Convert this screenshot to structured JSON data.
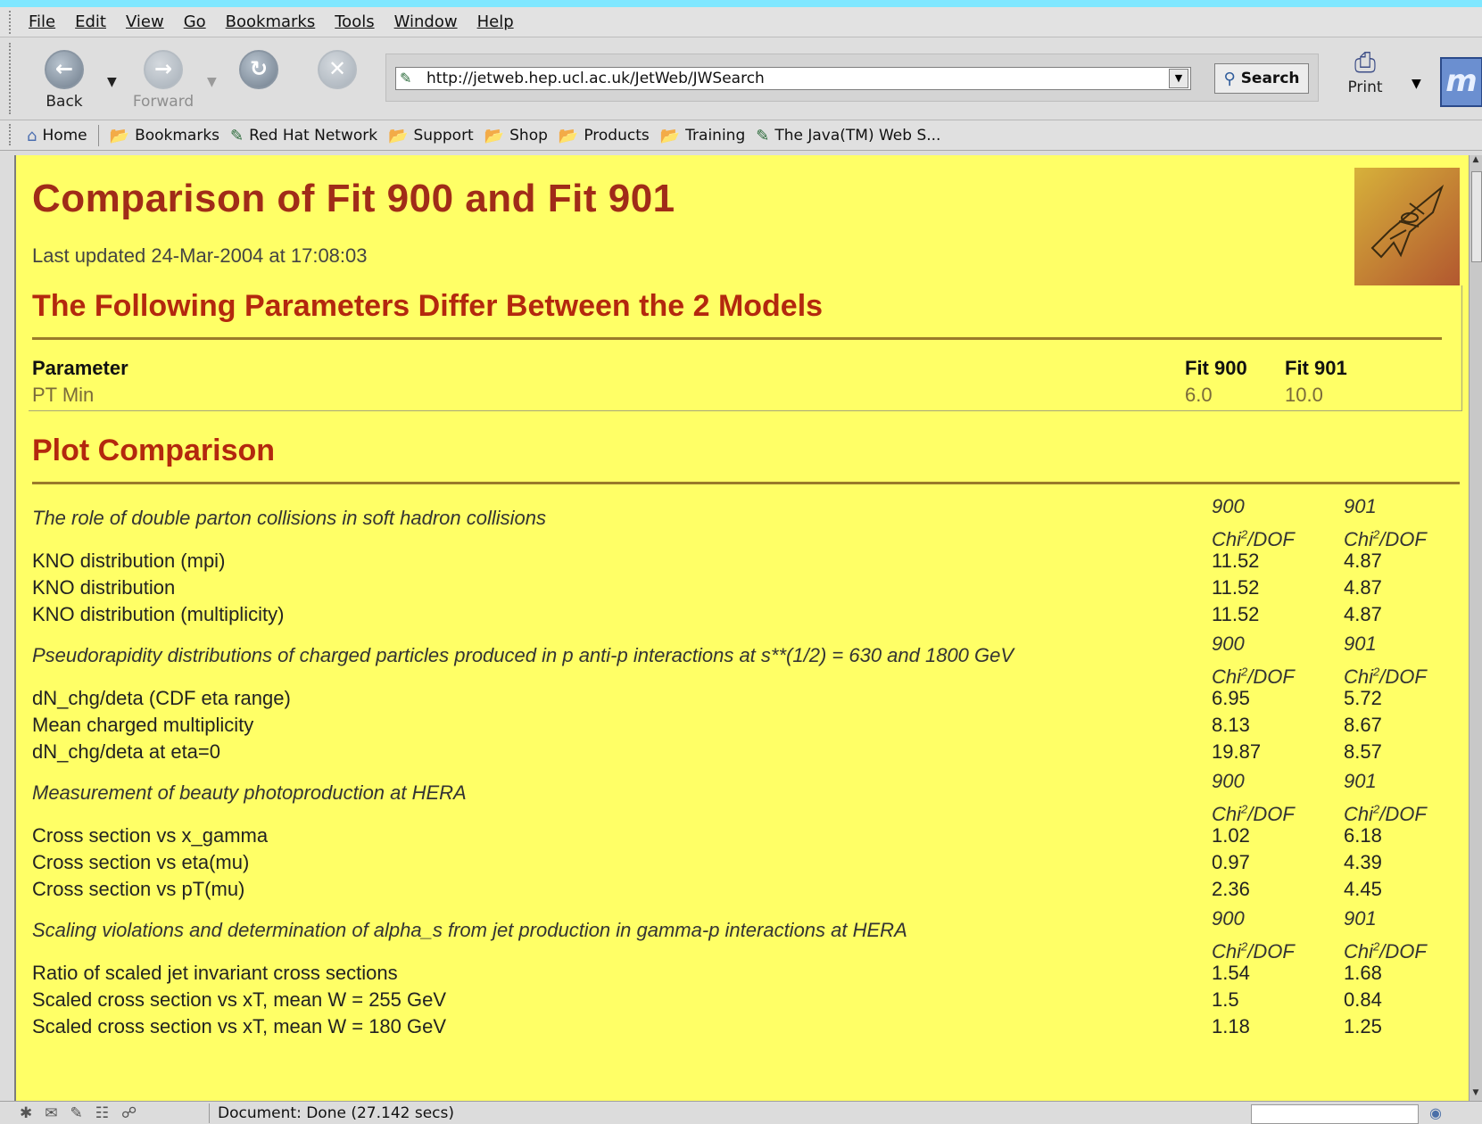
{
  "menubar": {
    "items": [
      {
        "label": "File"
      },
      {
        "label": "Edit"
      },
      {
        "label": "View"
      },
      {
        "label": "Go"
      },
      {
        "label": "Bookmarks"
      },
      {
        "label": "Tools"
      },
      {
        "label": "Window"
      },
      {
        "label": "Help"
      }
    ]
  },
  "navbar": {
    "back_label": "Back",
    "forward_label": "Forward",
    "url": "http://jetweb.hep.ucl.ac.uk/JetWeb/JWSearch",
    "search_label": "Search",
    "print_label": "Print"
  },
  "bookmarks": {
    "home": "Home",
    "bookmarks": "Bookmarks",
    "red_hat_network": "Red Hat Network",
    "support": "Support",
    "shop": "Shop",
    "products": "Products",
    "training": "Training",
    "java": "The Java(TM) Web S..."
  },
  "page": {
    "title": "Comparison of Fit 900 and Fit 901",
    "updated": "Last updated 24-Mar-2004 at 17:08:03",
    "params_heading": "The Following Parameters Differ Between the 2 Models",
    "params_table": {
      "col_param": "Parameter",
      "col_fit1": "Fit 900",
      "col_fit2": "Fit 901",
      "rows": [
        {
          "name": "PT Min",
          "fit1": "6.0",
          "fit2": "10.0"
        }
      ]
    },
    "plot_heading": "Plot Comparison",
    "group_col1": "900",
    "group_col2": "901",
    "chi_label": "Chi",
    "chi_sup": "2",
    "chi_suffix": "/DOF",
    "groups": [
      {
        "title": "The role of double parton collisions in soft hadron collisions",
        "rows": [
          {
            "name": "KNO distribution (mpi)",
            "v1": "11.52",
            "v2": "4.87"
          },
          {
            "name": "KNO distribution",
            "v1": "11.52",
            "v2": "4.87"
          },
          {
            "name": "KNO distribution (multiplicity)",
            "v1": "11.52",
            "v2": "4.87"
          }
        ]
      },
      {
        "title": "Pseudorapidity distributions of charged particles produced in p anti-p interactions at s**(1/2) = 630 and 1800 GeV",
        "rows": [
          {
            "name": "dN_chg/deta (CDF eta range)",
            "v1": "6.95",
            "v2": "5.72"
          },
          {
            "name": "Mean charged multiplicity",
            "v1": "8.13",
            "v2": "8.67"
          },
          {
            "name": "dN_chg/deta at eta=0",
            "v1": "19.87",
            "v2": "8.57"
          }
        ]
      },
      {
        "title": "Measurement of beauty photoproduction at HERA",
        "rows": [
          {
            "name": "Cross section vs x_gamma",
            "v1": "1.02",
            "v2": "6.18"
          },
          {
            "name": "Cross section vs eta(mu)",
            "v1": "0.97",
            "v2": "4.39"
          },
          {
            "name": "Cross section vs pT(mu)",
            "v1": "2.36",
            "v2": "4.45"
          }
        ]
      },
      {
        "title": "Scaling violations and determination of alpha_s from jet production in gamma-p interactions at HERA",
        "rows": [
          {
            "name": "Ratio of scaled jet invariant cross sections",
            "v1": "1.54",
            "v2": "1.68"
          },
          {
            "name": "Scaled cross section vs xT, mean W = 255 GeV",
            "v1": "1.5",
            "v2": "0.84"
          },
          {
            "name": "Scaled cross section vs xT, mean W = 180 GeV",
            "v1": "1.18",
            "v2": "1.25"
          }
        ]
      }
    ]
  },
  "statusbar": {
    "text": "Document: Done (27.142 secs)"
  }
}
